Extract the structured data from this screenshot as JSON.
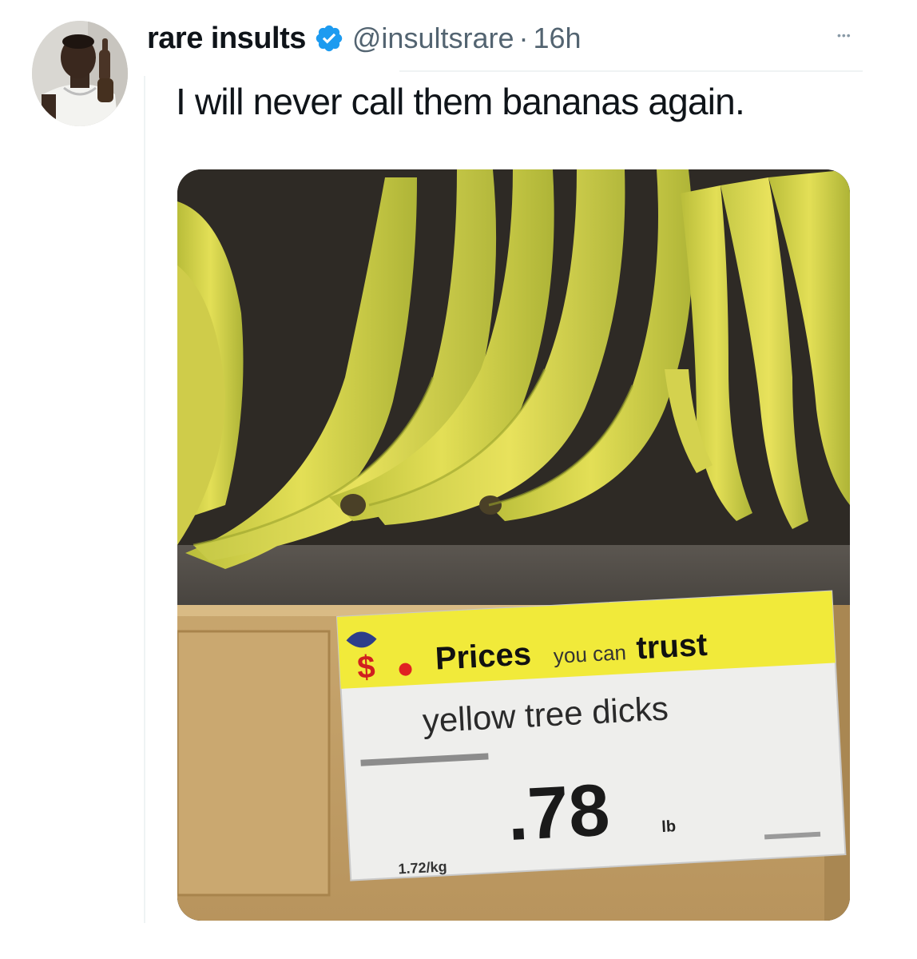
{
  "tweet": {
    "author_name": "rare insults",
    "handle": "@insultsrare",
    "separator": "·",
    "time": "16h",
    "text": "I will never call them bananas again."
  },
  "media": {
    "sign_slogan_1": "Prices",
    "sign_slogan_2": "you can",
    "sign_slogan_3": "trust",
    "product_name": "yellow tree dicks",
    "price": ".78",
    "price_unit": "lb",
    "unit_price": "1.72/kg"
  },
  "icons": {
    "verified": "verified-badge-icon",
    "more": "more-options-icon"
  },
  "colors": {
    "verified_badge": "#1d9bf0",
    "banana": "#d9d94a",
    "sign_yellow": "#f1ea3a"
  }
}
